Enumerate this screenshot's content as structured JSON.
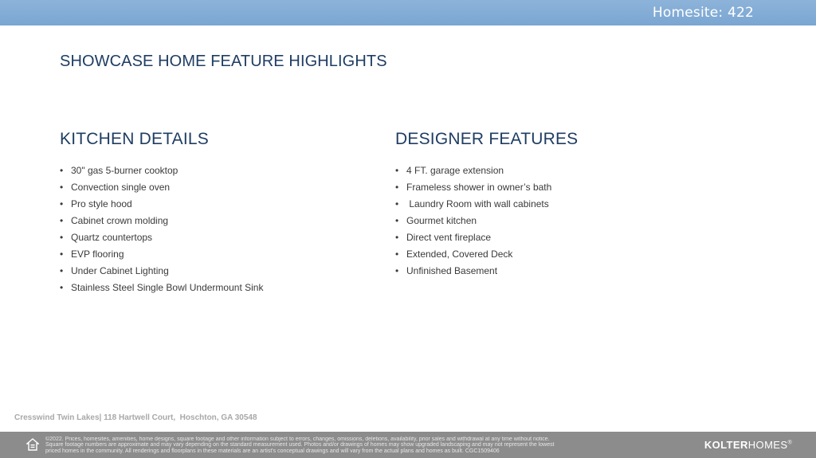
{
  "header": {
    "homesite": "Homesite: 422"
  },
  "page_title": "SHOWCASE HOME FEATURE HIGHLIGHTS",
  "kitchen": {
    "heading": "KITCHEN DETAILS",
    "items": [
      "30\" gas 5-burner cooktop",
      "Convection single oven",
      "Pro style hood",
      "Cabinet crown molding",
      "Quartz countertops",
      "EVP flooring",
      "Under Cabinet Lighting",
      "Stainless Steel Single Bowl Undermount Sink"
    ]
  },
  "designer": {
    "heading": "DESIGNER FEATURES",
    "items": [
      "4 FT. garage extension",
      "Frameless shower in owner’s bath",
      " Laundry Room with wall cabinets",
      "Gourmet kitchen",
      "Direct vent fireplace",
      "Extended, Covered Deck",
      "Unfinished Basement"
    ]
  },
  "address": "Cresswind Twin Lakes| 118 Hartwell Court,  Hoschton, GA 30548",
  "footer": {
    "disclaimer": "©2022. Prices, homesites, amenities, home designs, square footage and other information subject to errors, changes, omissions, deletions, availability, prior sales and withdrawal at any time without notice.\nSquare footage numbers are approximate and may vary depending on the standard measurement used. Photos and/or drawings of homes may show upgraded landscaping and may not represent the lowest\npriced homes in the community. All renderings and floorplans in these materials are an artist's conceptual drawings and will vary from the actual plans and homes as built. CGC1509406",
    "logo_bold": "KOLTER",
    "logo_light": "HOMES",
    "logo_mark": "®",
    "icon": "equal-housing-icon"
  }
}
